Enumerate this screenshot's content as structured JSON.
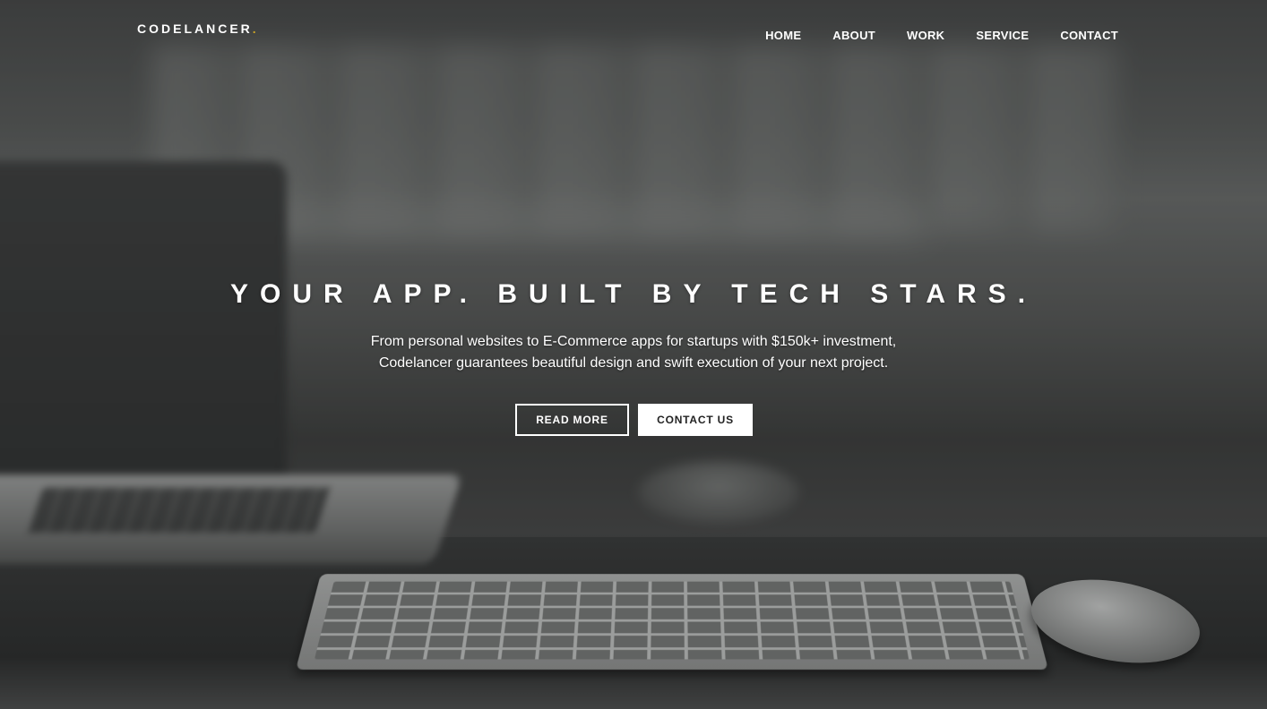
{
  "brand": {
    "name": "CODELANCER",
    "dot": ".",
    "accent_color": "#c9a227"
  },
  "nav": {
    "items": [
      {
        "label": "HOME"
      },
      {
        "label": "ABOUT"
      },
      {
        "label": "WORK"
      },
      {
        "label": "SERVICE"
      },
      {
        "label": "CONTACT"
      }
    ]
  },
  "hero": {
    "headline": "YOUR APP. BUILT BY TECH STARS.",
    "subline_1": "From personal websites to E-Commerce apps for startups with $150k+ investment,",
    "subline_2": "Codelancer guarantees beautiful design and swift execution of your next project.",
    "buttons": {
      "read_more": "READ MORE",
      "contact_us": "CONTACT US"
    }
  }
}
